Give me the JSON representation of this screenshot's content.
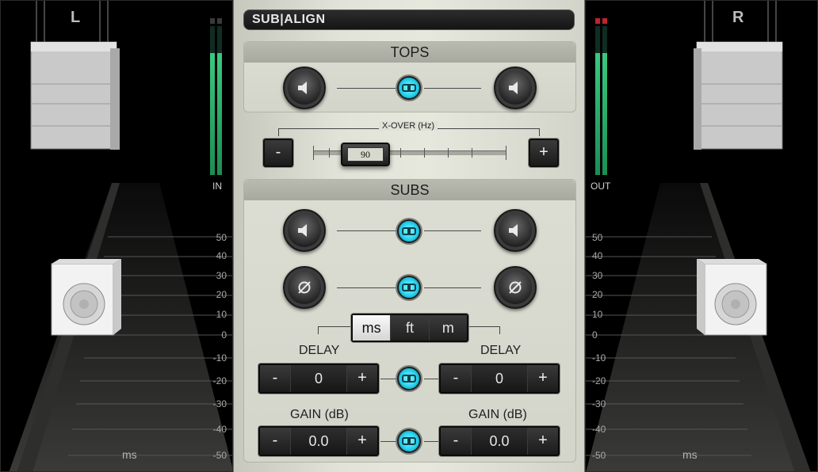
{
  "app": {
    "title": "SUB|ALIGN"
  },
  "left": {
    "channel": "L",
    "meter_label": "IN",
    "meter_level": 0.82
  },
  "right": {
    "channel": "R",
    "meter_label": "OUT",
    "meter_level": 0.82
  },
  "scale": [
    "50",
    "40",
    "30",
    "20",
    "10",
    "0",
    "-10",
    "-20",
    "-30",
    "-40",
    "-50"
  ],
  "scale_unit": "ms",
  "tops": {
    "heading": "TOPS",
    "xover_label": "X-OVER (Hz)",
    "xover_value": "90",
    "minus": "-",
    "plus": "+"
  },
  "subs": {
    "heading": "SUBS",
    "units": [
      "ms",
      "ft",
      "m"
    ],
    "active_unit": "ms",
    "delay_label": "DELAY",
    "gain_label": "GAIN (dB)",
    "delay_left": "0",
    "delay_right": "0",
    "gain_left": "0.0",
    "gain_right": "0.0",
    "minus": "-",
    "plus": "+"
  },
  "colors": {
    "link": "#26d3f0",
    "meter": "#39c97f",
    "clip": "#c0232b"
  }
}
